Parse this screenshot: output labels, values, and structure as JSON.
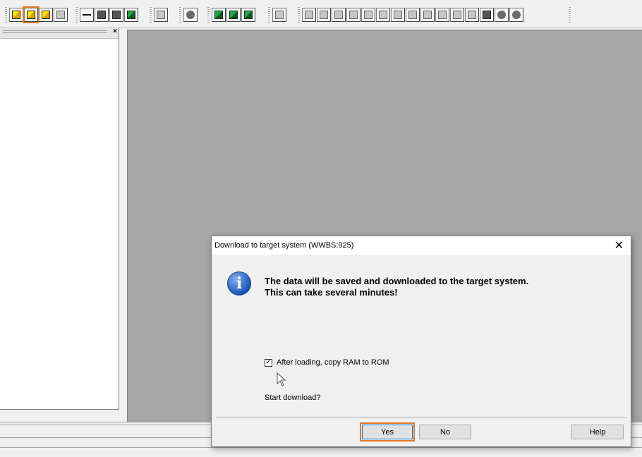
{
  "toolbar": {
    "groups": [
      [
        "yellow",
        "yellow-highlighted",
        "yellow",
        "gray"
      ],
      [
        "line",
        "dark",
        "dark",
        "green"
      ],
      [
        "gray"
      ],
      [
        "dot"
      ],
      [
        "green",
        "green",
        "green"
      ],
      [
        "gray"
      ],
      [
        "gray",
        "gray",
        "gray",
        "gray",
        "gray",
        "gray",
        "gray",
        "gray",
        "gray",
        "gray",
        "gray",
        "gray",
        "dark",
        "dot",
        "dot"
      ]
    ]
  },
  "dialog": {
    "title": "Download to target system (WWBS:925)",
    "message_line1": "The data will be saved and downloaded to the target system.",
    "message_line2": "This can take several minutes!",
    "checkbox_label": "After loading, copy RAM to ROM",
    "checkbox_checked": true,
    "prompt": "Start download?",
    "yes_label": "Yes",
    "no_label": "No",
    "help_label": "Help",
    "close_glyph": "✕",
    "info_glyph": "i"
  },
  "left_panel": {
    "close_glyph": "×"
  },
  "colors": {
    "highlight": "#e87722",
    "workspace": "#a6a6a6"
  }
}
